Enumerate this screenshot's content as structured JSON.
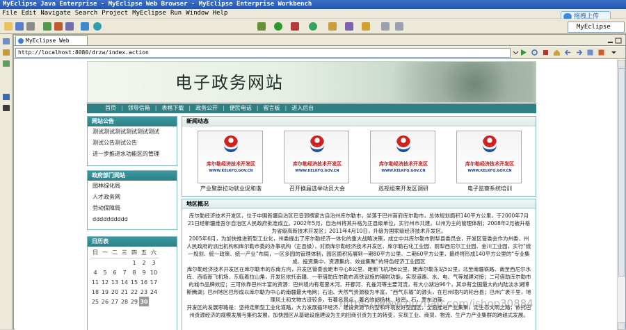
{
  "window": {
    "title": "MyEclipse Java Enterprise - MyEclipse Web Browser - MyEclipse Enterprise Workbench"
  },
  "menu": [
    "File",
    "Edit",
    "Navigate",
    "Search",
    "Project",
    "MyEclipse",
    "Run",
    "Window",
    "Help"
  ],
  "upload_button": "拖拽上传",
  "perspective": "MyEclipse ...",
  "editor_tab": "MyEclipse Web Browser",
  "url": "http://localhost:8080/drzw/index.action",
  "site": {
    "title": "电子政务网站",
    "nav": [
      "首页",
      "领导信箱",
      "表格下载",
      "政务公开",
      "便民电话",
      "留言板",
      "进入后台"
    ],
    "notice": {
      "heading": "网站公告",
      "items": [
        "测试测试测试测试测试测试",
        "测试公告测试公告",
        "进一步推进水功能区的管理"
      ]
    },
    "departments": {
      "heading": "政府部门网站",
      "items": [
        "园林绿化局",
        "人才政务网",
        "劳动保障局",
        "dddddddddd"
      ]
    },
    "calendar": {
      "heading": "日历表",
      "weekdays": [
        "日",
        "一",
        "二",
        "三",
        "四",
        "五",
        "六"
      ],
      "rows": [
        [
          "",
          "",
          "",
          "",
          "1",
          "2",
          "3"
        ],
        [
          "4",
          "5",
          "6",
          "7",
          "8",
          "9",
          "10"
        ],
        [
          "11",
          "12",
          "13",
          "14",
          "15",
          "16",
          "17"
        ],
        [
          "18",
          "19",
          "20",
          "21",
          "22",
          "23",
          "24"
        ],
        [
          "25",
          "26",
          "27",
          "28",
          "29",
          "30",
          ""
        ]
      ],
      "today": "30"
    },
    "news": {
      "heading": "新闻动态",
      "logo_text": "库尔勒经济技术开发区",
      "logo_url": "WWW.KELKFQ.GOV.CN",
      "items": [
        "产业聚群拉动就业促和谐",
        "召开换届选举动员大会",
        "巡视组来开发区调研",
        "电子监察系统培训"
      ]
    },
    "intro": {
      "heading": "地区概况",
      "paragraphs": [
        "库尔勒经济技术开发区，位于中国新疆自治区巴音郭楞蒙古自治州库尔勒市，坐落于巴州首府库尔勒市，总体规划面积140平方公里，于2000年7月21日经新疆维吾尔自治区人民政府批准成立。2002年5月，自治州将其升格为正县级单位，实行州市共建，以州为主的管理体制；2008年2月被升格为省级高新技术开发区；2011年4月10日，升级为国家级经济技术开发区。",
        "2005年6月，为加快推进新型工业化，州委提出了库尔勒经济一体化的重大战略决策，成立中共库尔勒市尉犁县委员会，开发区管委会作为州委、州人民政府的派出机构和库尔勒市委的办事机构（正县级），对原库尔勒经济技术开发区、库尔勒石化工业园、尉犁西尼尔工业园、金川工业园，实行“统一规划、统一政策、统一产业”布局，一区多园的管理体制，园区面积拓展到一期80平方公里、二期60平方公里，最终将形成140平方公里的“专业集成、投资集中、资源集约、效益集聚”的特色经济工业园区",
        "库尔勒经济技术开发区在库尔勒市的东南方向，开发区管委会距市中心8公里、距新飞机场6公里、距库尔勒东站5公里，北至南疆铁路、南至西尼尔水库、西临新飞机场、东临着拉山角，开发区依托南疆、一带借助库尔勒市高铁设施的辐射功能，实现道路、水、电、气等城建对接；二可借助库尔勒市的城市品牌效应；三可依靠巴州丰富的资源：巴州境内有塔里木河、开都河、孔雀河等主要河流，有大小湖泊96个，其中有全国最大的内陆淡水湖博斯腾湖；巴州地区巴形成以库尔勒为中心的南疆最大电网；石油、天然气资源极为丰富，“西气东输”的源头，在巴州境内的轮台县；巴州广袤千里，地理风土和文物古迹较多，有著名景点，著名的胡杨林、哈密，石，罗布泊等。",
        "开发区的发展思路是：坚持走新型工业化道路，大力发展循环经济，建设资源节约型和环境友好型园区，全面推进产业集聚，走生态文明之路；依托巴州资源经济的规模发展与集约发展，加快园区从基础设施建设为主向招商引资为主的转变，实现工业、商贸、物流、生产力产业集群的跨越式发展。"
      ]
    }
  },
  "watermark": "https://www.huzhan.com/ishop30884"
}
